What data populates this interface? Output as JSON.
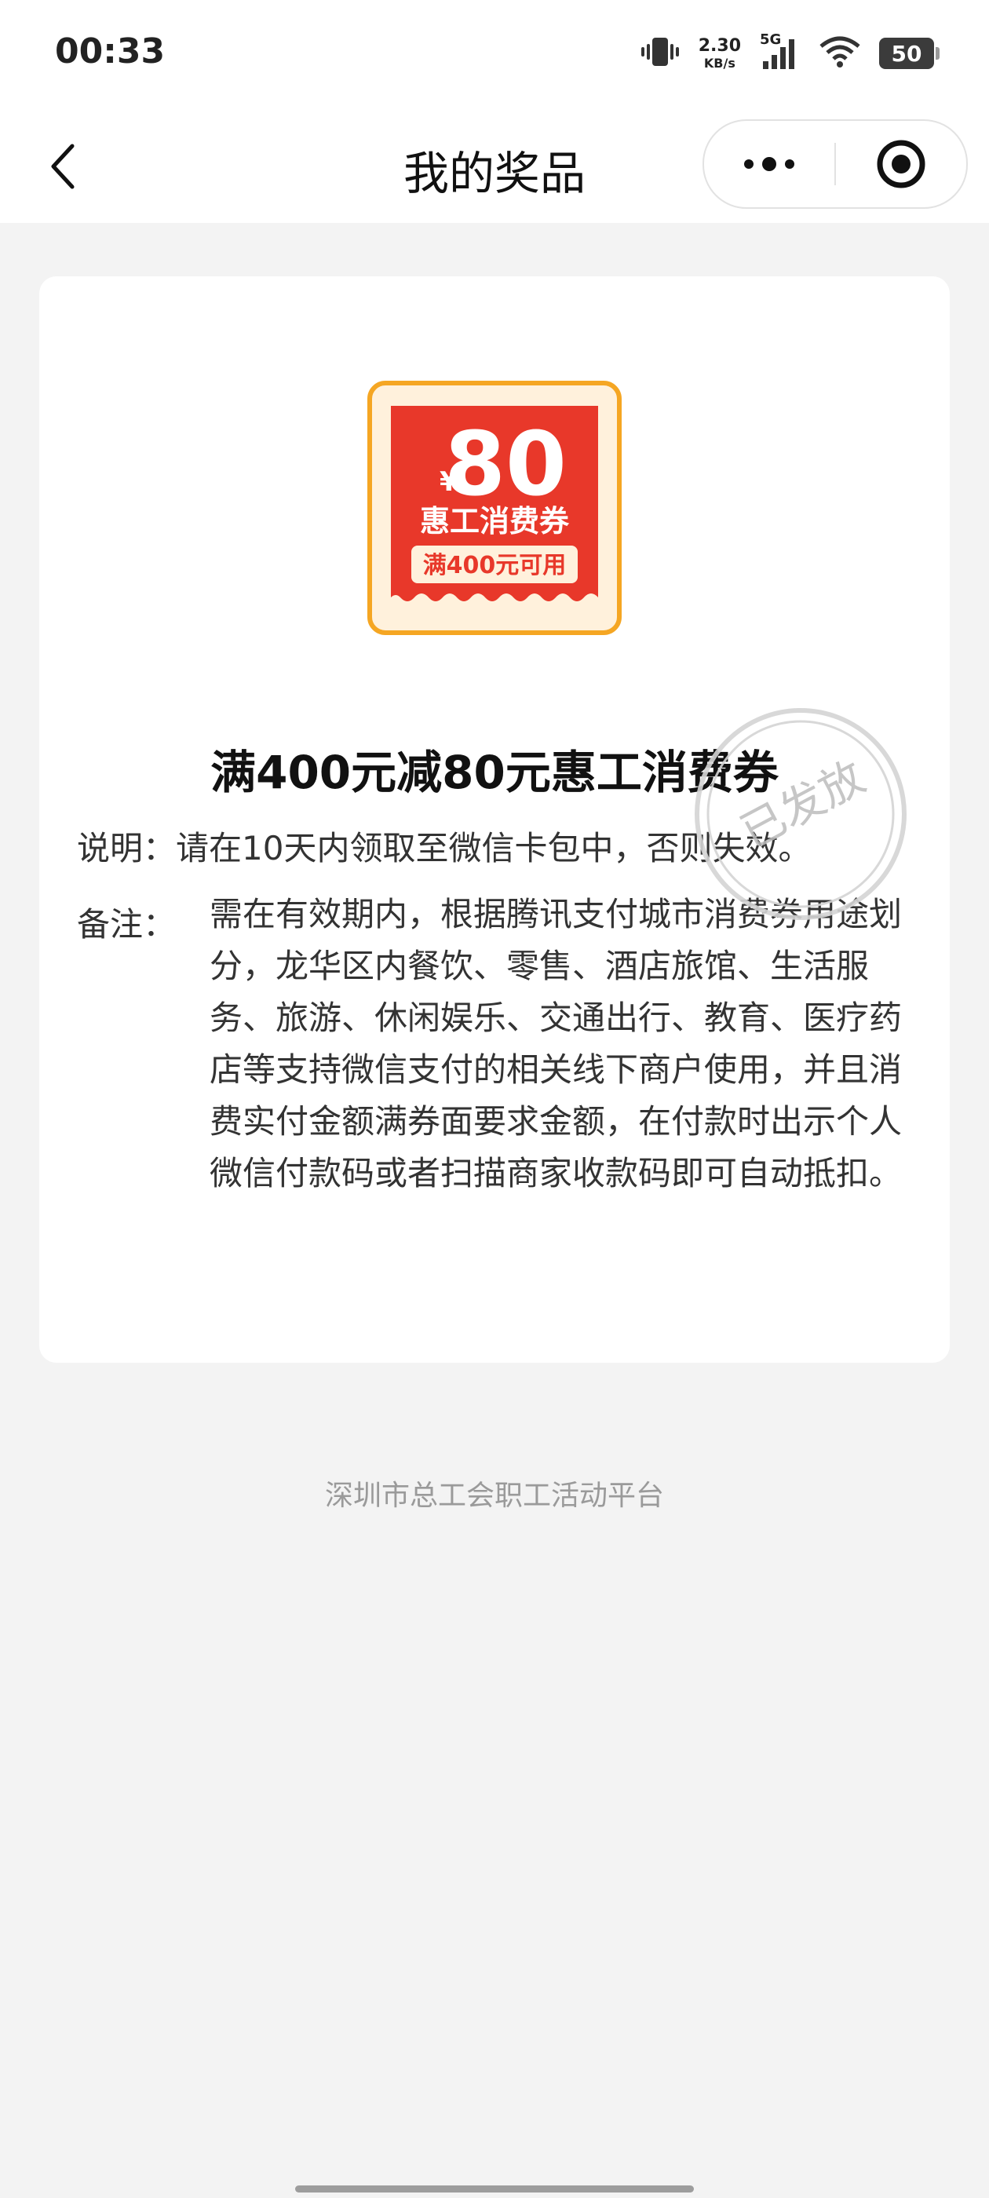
{
  "status_bar": {
    "time": "00:33",
    "net_speed_value": "2.30",
    "net_speed_unit": "KB/s",
    "network": "5G",
    "battery": "50",
    "icons": [
      "vibrate-icon",
      "signal-icon",
      "wifi-icon",
      "battery-icon"
    ]
  },
  "nav": {
    "title": "我的奖品",
    "back_icon": "chevron-left-icon",
    "more_icon": "more-dots-icon",
    "close_icon": "target-close-icon"
  },
  "coupon": {
    "currency": "¥",
    "amount": "80",
    "name": "惠工消费券",
    "condition": "满400元可用",
    "colors": {
      "frame": "#f5a623",
      "red": "#e8382a",
      "cream": "#fff1dc"
    }
  },
  "prize": {
    "title": "满400元减80元惠工消费券",
    "description": "说明：请在10天内领取至微信卡包中，否则失效。",
    "note_label": "备注：",
    "note_text": "需在有效期内，根据腾讯支付城市消费券用途划分，龙华区内餐饮、零售、酒店旅馆、生活服务、旅游、休闲娱乐、交通出行、教育、医疗药店等支持微信支付的相关线下商户使用，并且消费实付金额满券面要求金额，在付款时出示个人微信付款码或者扫描商家收款码即可自动抵扣。",
    "stamp_text": "已发放"
  },
  "footer": {
    "text": "深圳市总工会职工活动平台"
  }
}
